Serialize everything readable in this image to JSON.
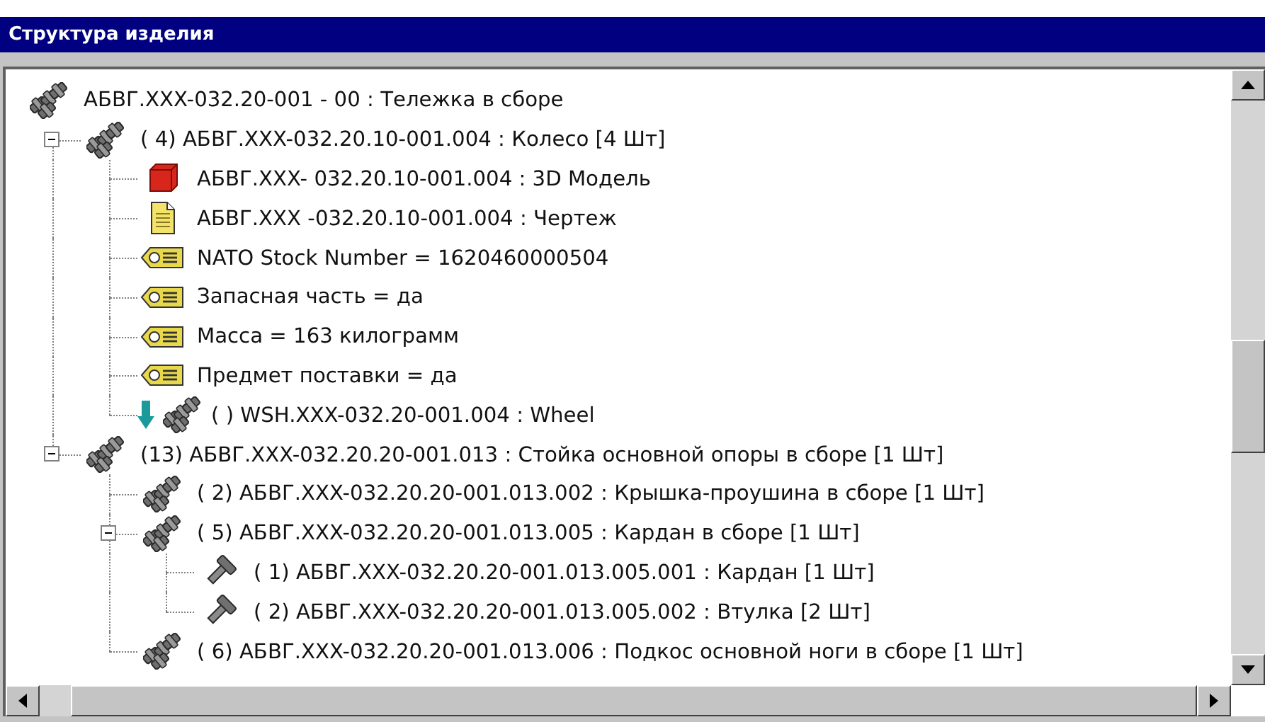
{
  "window": {
    "title": "Структура изделия"
  },
  "tree": {
    "kind": "assembly",
    "label": "АБВГ.XXX-032.20-001 - 00 : Тележка в сборе",
    "children": [
      {
        "kind": "assembly",
        "label": "( 4) АБВГ.XXX-032.20.10-001.004 : Колесо [4 Шт]",
        "expanded": true,
        "children": [
          {
            "kind": "model",
            "label": "АБВГ.XXX- 032.20.10-001.004 : 3D Модель"
          },
          {
            "kind": "drawing",
            "label": "АБВГ.XXX -032.20.10-001.004 : Чертеж"
          },
          {
            "kind": "attribute",
            "label": "NATO Stock Number = 1620460000504"
          },
          {
            "kind": "attribute",
            "label": "Запасная часть = да"
          },
          {
            "kind": "attribute",
            "label": "Масса = 163 килограмм"
          },
          {
            "kind": "attribute",
            "label": "Предмет поставки = да"
          },
          {
            "kind": "linked",
            "label": "( ) WSH.XXX-032.20-001.004 : Wheel"
          }
        ]
      },
      {
        "kind": "assembly",
        "label": "(13) АБВГ.XXX-032.20.20-001.013 : Стойка основной опоры в сборе [1 Шт]",
        "expanded": true,
        "children": [
          {
            "kind": "assembly",
            "label": "( 2) АБВГ.XXX-032.20.20-001.013.002 : Крышка-проушина в сборе [1 Шт]"
          },
          {
            "kind": "assembly",
            "label": "( 5) АБВГ.XXX-032.20.20-001.013.005 : Кардан в сборе [1 Шт]",
            "expanded": true,
            "children": [
              {
                "kind": "part",
                "label": "( 1) АБВГ.XXX-032.20.20-001.013.005.001 : Кардан [1 Шт]"
              },
              {
                "kind": "part",
                "label": "( 2) АБВГ.XXX-032.20.20-001.013.005.002 : Втулка [2 Шт]"
              }
            ]
          },
          {
            "kind": "assembly",
            "label": "( 6) АБВГ.XXX-032.20.20-001.013.006 : Подкос основной ноги в сборе [1 Шт]"
          }
        ]
      }
    ]
  }
}
